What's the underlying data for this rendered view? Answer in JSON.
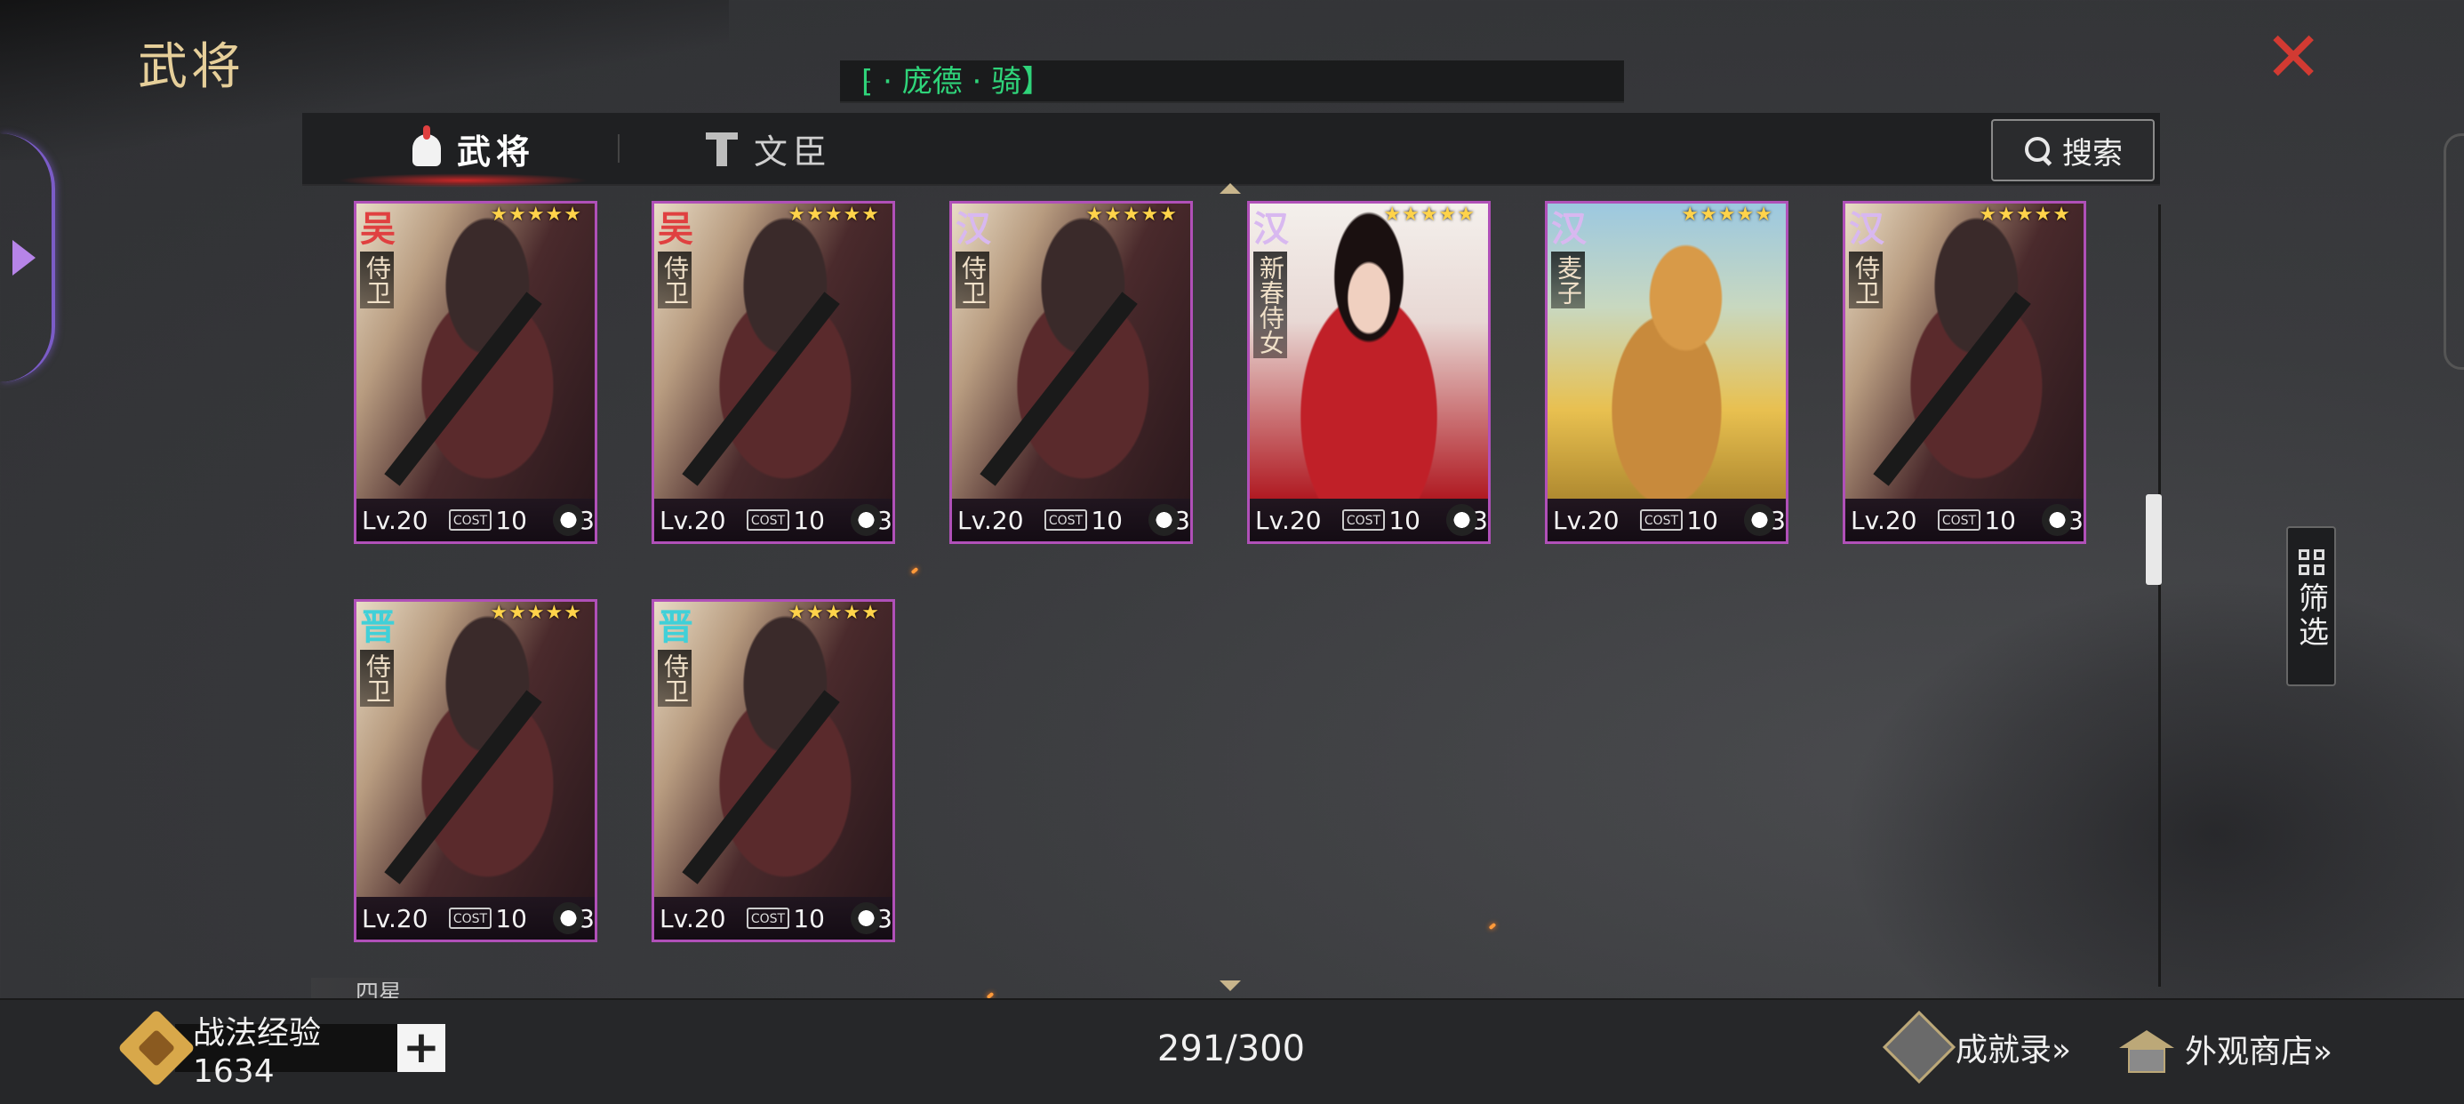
{
  "header": {
    "title": "武将",
    "marquee": " \u0000 · 庞德 · 骑】"
  },
  "tabs": [
    {
      "label": "武将",
      "active": true
    },
    {
      "label": "文臣",
      "active": false
    }
  ],
  "search": {
    "label": "搜索"
  },
  "filter": {
    "label": "筛选"
  },
  "cards": [
    {
      "faction": "吴",
      "name": "侍卫",
      "stars": "★★★★★",
      "level": "Lv.20",
      "cost": "10",
      "unit_count": "3",
      "unit_icon": "bow-icon",
      "art": "guard"
    },
    {
      "faction": "吴",
      "name": "侍卫",
      "stars": "★★★★★",
      "level": "Lv.20",
      "cost": "10",
      "unit_count": "3",
      "unit_icon": "horse-icon",
      "art": "guard"
    },
    {
      "faction": "汉",
      "name": "侍卫",
      "stars": "★★★★★",
      "level": "Lv.20",
      "cost": "10",
      "unit_count": "3",
      "unit_icon": "shield-icon",
      "art": "guard"
    },
    {
      "faction": "汉",
      "name": "新春侍女",
      "stars": "★★★★★",
      "level": "Lv.20",
      "cost": "10",
      "unit_count": "3",
      "unit_icon": "horse-icon",
      "art": "maid"
    },
    {
      "faction": "汉",
      "name": "麦子",
      "stars": "★★★★★",
      "level": "Lv.20",
      "cost": "10",
      "unit_count": "3",
      "unit_icon": "horse-icon",
      "art": "dog"
    },
    {
      "faction": "汉",
      "name": "侍卫",
      "stars": "★★★★★",
      "level": "Lv.20",
      "cost": "10",
      "unit_count": "3",
      "unit_icon": "horse-icon",
      "art": "guard"
    },
    {
      "faction": "晋",
      "name": "侍卫",
      "stars": "★★★★★",
      "level": "Lv.20",
      "cost": "10",
      "unit_count": "3",
      "unit_icon": "bow-icon",
      "art": "guard"
    },
    {
      "faction": "晋",
      "name": "侍卫",
      "stars": "★★★★★",
      "level": "Lv.20",
      "cost": "10",
      "unit_count": "3",
      "unit_icon": "horse-icon",
      "art": "guard"
    }
  ],
  "cost_label": "COST",
  "section_peek": "四星",
  "footer": {
    "exp_label": "战法经验 1634",
    "plus": "+",
    "count": "291/300",
    "achievements": "成就录»",
    "shop": "外观商店»"
  },
  "colors": {
    "wu": "#e04040",
    "han": "#d8b8f0",
    "jin": "#40d0d8",
    "card_border": "#b050b8",
    "marquee_text": "#2fd47a",
    "close": "#d23a32"
  }
}
